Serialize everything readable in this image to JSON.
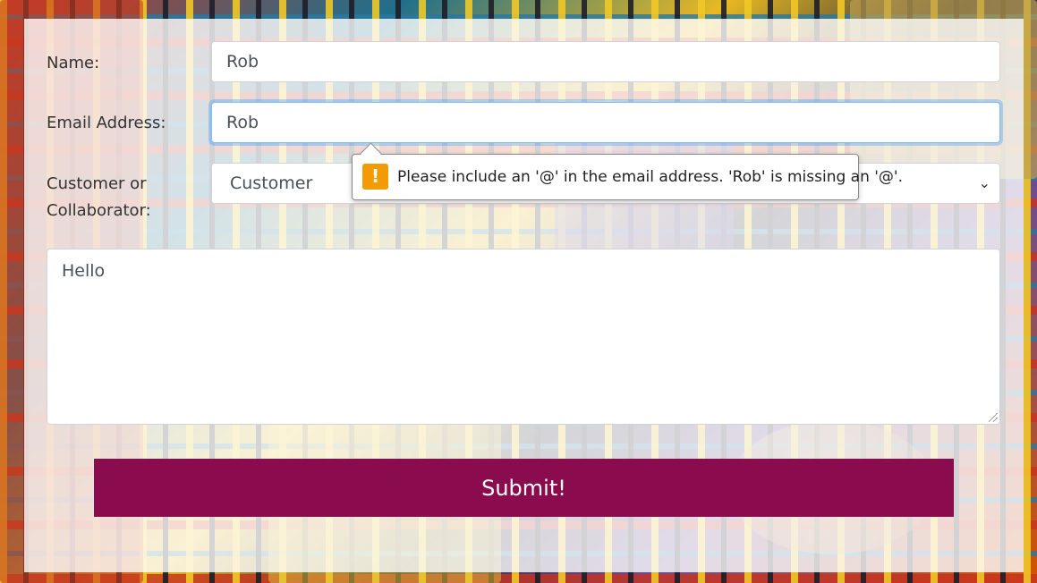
{
  "form": {
    "name_label": "Name:",
    "name_value": "Rob",
    "email_label": "Email Address:",
    "email_value": "Rob",
    "type_label_line1": "Customer or",
    "type_label_line2": "Collaborator:",
    "type_selected": "Customer",
    "message_value": "Hello",
    "submit_label": "Submit!"
  },
  "validation": {
    "message": "Please include an '@' in the email address. 'Rob' is missing an '@'.",
    "icon": "warning-icon",
    "icon_color": "#f29b05"
  },
  "colors": {
    "submit_bg": "#8a0c4e",
    "focus_border": "#80bdff"
  }
}
